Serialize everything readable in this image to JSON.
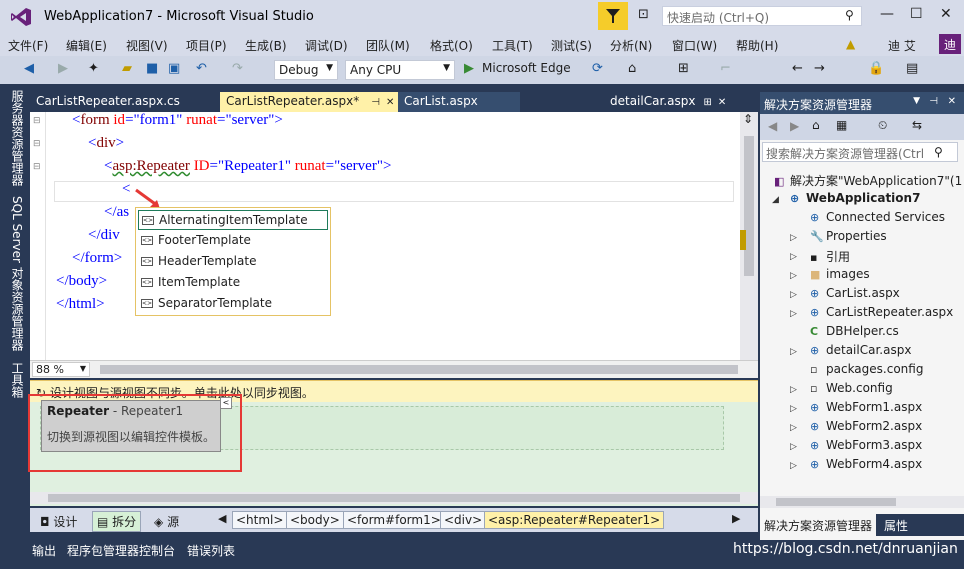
{
  "titlebar": {
    "title": "WebApplication7 - Microsoft Visual Studio",
    "quick_launch_placeholder": "快速启动 (Ctrl+Q)"
  },
  "menu": [
    "文件(F)",
    "编辑(E)",
    "视图(V)",
    "项目(P)",
    "生成(B)",
    "调试(D)",
    "团队(M)",
    "格式(O)",
    "工具(T)",
    "测试(S)",
    "分析(N)",
    "窗口(W)",
    "帮助(H)"
  ],
  "user": {
    "name": "迪 艾",
    "badge": "迪"
  },
  "toolbar": {
    "config": "Debug",
    "platform": "Any CPU",
    "run_label": "Microsoft Edge"
  },
  "left_tabs": [
    "服务器资源管理器",
    "SQL Server 对象资源管理器",
    "工具箱"
  ],
  "doc_tabs": [
    "CarListRepeater.aspx.cs",
    "CarListRepeater.aspx*",
    "CarList.aspx",
    "detailCar.aspx"
  ],
  "code": {
    "l1": {
      "open": "<",
      "tag": "form",
      "a1": " id",
      "v1": "=\"form1\"",
      "a2": " runat",
      "v2": "=\"server\"",
      "close": ">"
    },
    "l2": {
      "open": "<",
      "tag": "div",
      "close": ">"
    },
    "l3": {
      "open": "<",
      "tag": "asp:Repeater",
      "a1": " ID",
      "v1": "=\"Repeater1\"",
      "a2": " runat",
      "v2": "=\"server\"",
      "close": ">"
    },
    "l4": "<",
    "l5": "</as",
    "l6": "</div",
    "l7": "</form>",
    "l8": "</body>",
    "l9": "</html>"
  },
  "intellisense": [
    "AlternatingItemTemplate",
    "FooterTemplate",
    "HeaderTemplate",
    "ItemTemplate",
    "SeparatorTemplate"
  ],
  "zoom": "88 %",
  "sync_message": "设计视图与源视图不同步。单击此处以同步视图。",
  "tooltip": {
    "title": "Repeater",
    "subtitle": " - Repeater1",
    "body": "切换到源视图以编辑控件模板。"
  },
  "view_buttons": [
    "设计",
    "拆分",
    "源"
  ],
  "breadcrumbs": [
    "<html>",
    "<body>",
    "<form#form1>",
    "<div>",
    "<asp:Repeater#Repeater1>"
  ],
  "solution_explorer": {
    "title": "解决方案资源管理器",
    "search_placeholder": "搜索解决方案资源管理器(Ctrl",
    "solution": "解决方案\"WebApplication7\"(1",
    "project": "WebApplication7",
    "items": [
      "Connected Services",
      "Properties",
      "引用",
      "images",
      "CarList.aspx",
      "CarListRepeater.aspx",
      "DBHelper.cs",
      "detailCar.aspx",
      "packages.config",
      "Web.config",
      "WebForm1.aspx",
      "WebForm2.aspx",
      "WebForm3.aspx",
      "WebForm4.aspx"
    ],
    "bottom_tabs": [
      "解决方案资源管理器",
      "属性"
    ]
  },
  "status_tabs": [
    "输出",
    "程序包管理器控制台",
    "错误列表"
  ],
  "watermark": "https://blog.csdn.net/dnruanjian",
  "colors": {
    "accent": "#68217a",
    "highlight_tab": "#fff1a8",
    "annotation": "#e53935"
  }
}
